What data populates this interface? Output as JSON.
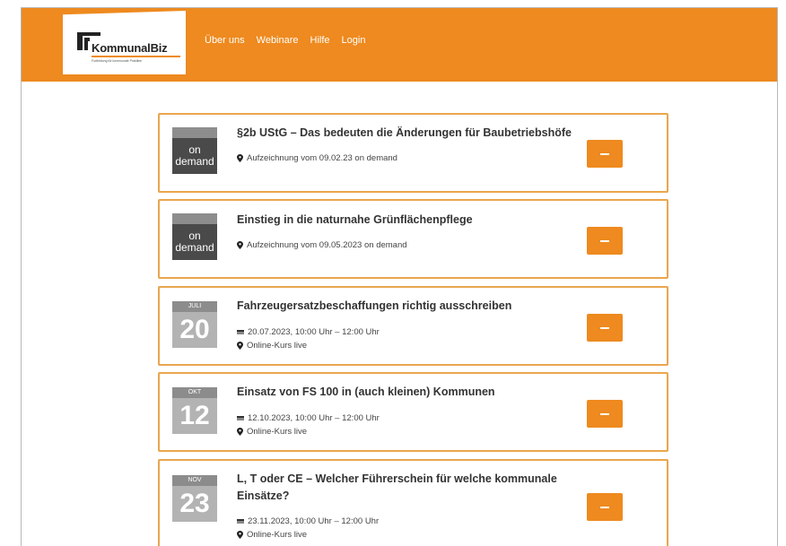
{
  "brand": {
    "name": "KommunalBiz",
    "tagline": "Fortbildung für kommunale Praktiker",
    "accent": "#ee8a1f"
  },
  "nav": {
    "items": [
      "Über uns",
      "Webinare",
      "Hilfe",
      "Login"
    ]
  },
  "events": [
    {
      "badge_top": "",
      "badge_main": "on demand",
      "title": "§2b UStG – Das bedeuten die Änderungen für Baubetriebshöfe",
      "date_line": "",
      "location_line": "Aufzeichnung vom 09.02.23 on demand"
    },
    {
      "badge_top": "",
      "badge_main": "on demand",
      "title": "Einstieg in die naturnahe Grünflächenpflege",
      "date_line": "",
      "location_line": "Aufzeichnung vom 09.05.2023 on demand"
    },
    {
      "badge_top": "JULI",
      "badge_main": "20",
      "title": "Fahrzeugersatzbeschaffungen richtig ausschreiben",
      "date_line": "20.07.2023, 10:00 Uhr – 12:00 Uhr",
      "location_line": "Online-Kurs live"
    },
    {
      "badge_top": "OKT",
      "badge_main": "12",
      "title": "Einsatz von FS 100 in (auch kleinen) Kommunen",
      "date_line": "12.10.2023, 10:00 Uhr – 12:00 Uhr",
      "location_line": "Online-Kurs live"
    },
    {
      "badge_top": "NOV",
      "badge_main": "23",
      "title": "L, T oder CE – Welcher Führerschein für welche kommunale Einsätze?",
      "date_line": "23.11.2023, 10:00 Uhr – 12:00 Uhr",
      "location_line": "Online-Kurs live"
    }
  ]
}
